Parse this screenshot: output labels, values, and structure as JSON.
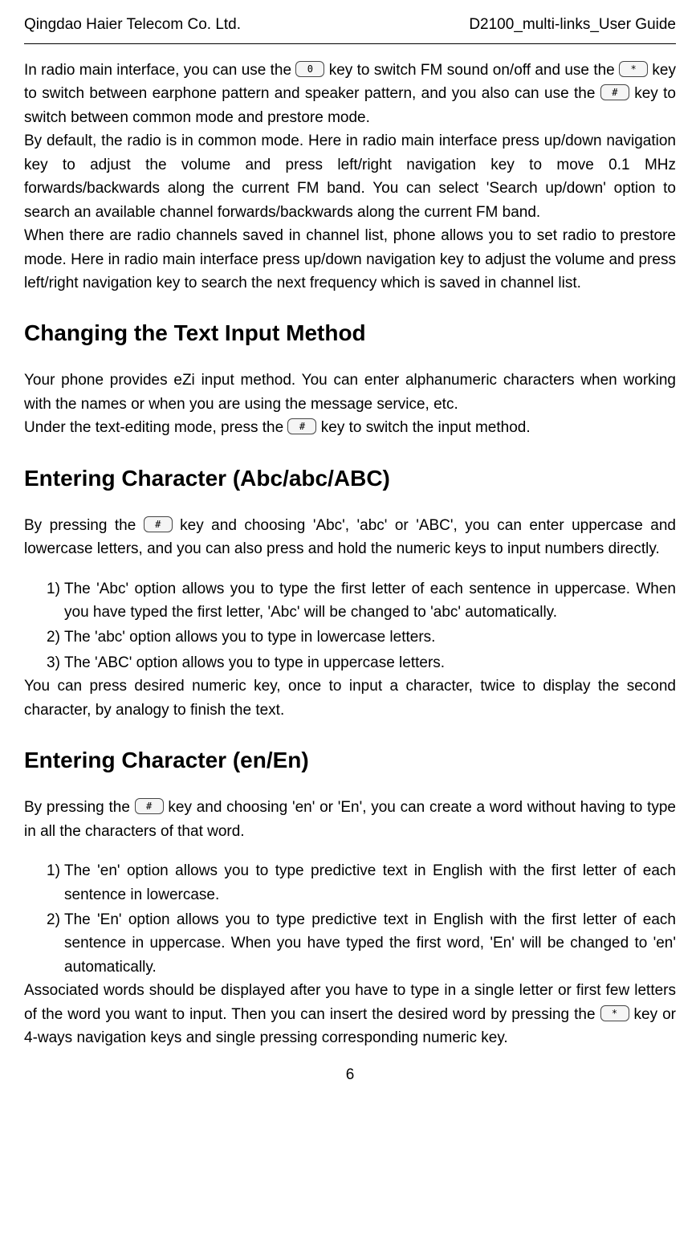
{
  "header": {
    "left": "Qingdao Haier Telecom Co. Ltd.",
    "right": "D2100_multi-links_User Guide"
  },
  "para1": {
    "p1_a": "In radio main interface, you can use the ",
    "icon1_label": "0",
    "p1_b": " key to switch FM sound on/off and use the ",
    "icon2_label": "*",
    "p1_c": " key to switch between earphone pattern and speaker pattern, and you also can use the ",
    "icon3_label": "#",
    "p1_d": " key to switch between common mode and prestore mode.",
    "p2": "By default, the radio is in common mode. Here in radio main interface press up/down navigation key to adjust the volume and press left/right navigation key to move 0.1 MHz forwards/backwards along the current FM band. You can select 'Search up/down' option to search an available channel forwards/backwards along the current FM band.",
    "p3": "When there are radio channels saved in channel list, phone allows you to set radio to prestore mode. Here in radio main interface press up/down navigation key to adjust the volume and press left/right navigation key to search the next frequency which is saved in channel list."
  },
  "section1": {
    "heading": "Changing the Text Input Method",
    "p1": "Your phone provides eZi input method. You can enter alphanumeric characters when working with the names or when you are using the message service, etc.",
    "p2_a": "Under the text-editing mode, press the ",
    "icon_label": "#",
    "p2_b": " key to switch the input method."
  },
  "section2": {
    "heading": "Entering Character (Abc/abc/ABC)",
    "p1_a": "By pressing the ",
    "icon_label": "#",
    "p1_b": " key and choosing 'Abc', 'abc' or 'ABC', you can enter uppercase and lowercase letters, and you can also press and hold the numeric keys to input numbers directly.",
    "list": [
      {
        "num": "1)",
        "text": "The 'Abc' option allows you to type the first letter of each sentence in uppercase. When you have typed the first letter, 'Abc' will be changed to 'abc' automatically."
      },
      {
        "num": "2)",
        "text": "The 'abc' option allows you to type in lowercase letters."
      },
      {
        "num": "3)",
        "text": "The 'ABC' option allows you to type in uppercase letters."
      }
    ],
    "p_after": "You can press desired numeric key, once to input a character, twice to display the second character, by analogy to finish the text."
  },
  "section3": {
    "heading": "Entering Character (en/En)",
    "p1_a": "By pressing the ",
    "icon1_label": "#",
    "p1_b": " key and choosing 'en' or 'En', you can create a word without having to type in all the characters of that word.",
    "list": [
      {
        "num": "1)",
        "text": "The 'en' option allows you to type predictive text in English with the first letter of each sentence in lowercase."
      },
      {
        "num": "2)",
        "text": "The 'En' option allows you to type predictive text in English with the first letter of each sentence in uppercase. When you have typed the first word, 'En' will be changed to 'en' automatically."
      }
    ],
    "p_after_a": "Associated words should be displayed after you have to type in a single letter or first few letters of the word you want to input. Then you can insert the desired word by pressing the ",
    "icon2_label": "*",
    "p_after_b": " key or 4-ways navigation keys and single pressing corresponding numeric key."
  },
  "footer": {
    "page_num": "6"
  }
}
